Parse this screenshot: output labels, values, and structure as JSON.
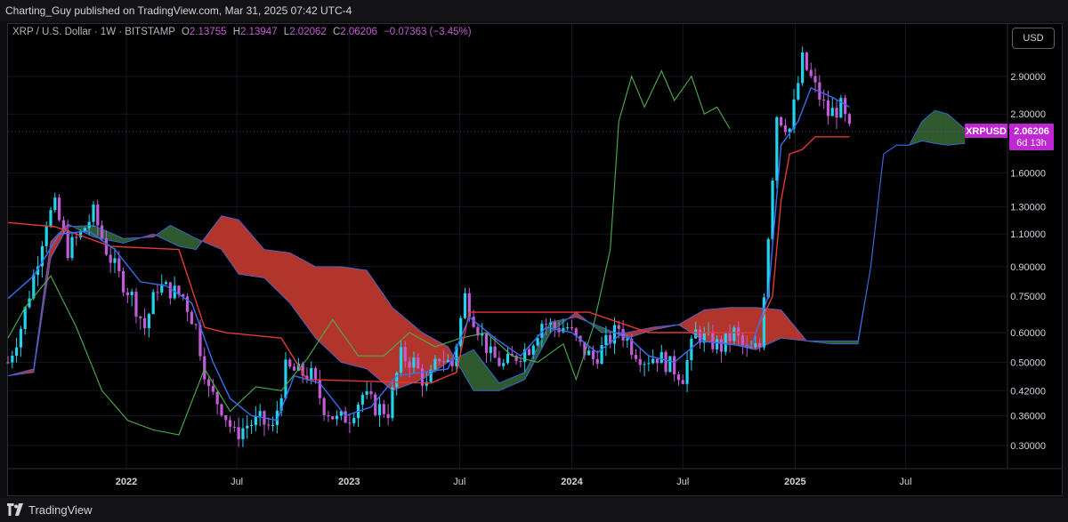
{
  "header": {
    "text": "Charting_Guy published on TradingView.com, Mar 31, 2025 07:42 UTC-4"
  },
  "legend": {
    "symbol": "XRP / U.S. Dollar · 1W · BITSTAMP",
    "o_label": "O",
    "o": "2.13755",
    "h_label": "H",
    "h": "2.13947",
    "l_label": "L",
    "l": "2.02062",
    "c_label": "C",
    "c": "2.06206",
    "change": "−0.07363 (−3.45%)"
  },
  "currency_button": "USD",
  "price_tag": {
    "symbol": "XRPUSD",
    "price": "2.06206",
    "countdown": "6d 13h"
  },
  "footer": {
    "brand": "TradingView"
  },
  "colors": {
    "background": "#000000",
    "bull": "#22d3ee",
    "bear": "#c45bd6",
    "tenkan": "#3b6df2",
    "kijun": "#e53935",
    "chikou": "#4caf50",
    "cloud_bull": "#2e5a2e",
    "cloud_bear": "#b2352b",
    "tag": "#c026d3"
  },
  "chart_data": {
    "type": "line",
    "title": "",
    "scale": "log",
    "ylim": [
      0.26,
      4.0
    ],
    "y_ticks": [
      "2.90000",
      "2.30000",
      "1.60000",
      "1.30000",
      "1.10000",
      "0.90000",
      "0.75000",
      "0.60000",
      "0.50000",
      "0.42000",
      "0.36000",
      "0.30000"
    ],
    "y_tick_values": [
      2.9,
      2.3,
      1.6,
      1.3,
      1.1,
      0.9,
      0.75,
      0.6,
      0.5,
      0.42,
      0.36,
      0.3
    ],
    "x_ticks": [
      {
        "label": "2022",
        "date": "2022-01-01"
      },
      {
        "label": "Jul",
        "date": "2022-07-01"
      },
      {
        "label": "2023",
        "date": "2023-01-01"
      },
      {
        "label": "Jul",
        "date": "2023-07-01"
      },
      {
        "label": "2024",
        "date": "2024-01-01"
      },
      {
        "label": "Jul",
        "date": "2024-07-01"
      },
      {
        "label": "2025",
        "date": "2025-01-01"
      },
      {
        "label": "Jul",
        "date": "2025-07-01"
      }
    ],
    "x_range": [
      "2021-06-21",
      "2025-12-15"
    ],
    "last_price": 2.06206,
    "price_path": [
      [
        "2021-06-21",
        0.5
      ],
      [
        "2021-07-12",
        0.62
      ],
      [
        "2021-08-02",
        0.85
      ],
      [
        "2021-08-23",
        1.2
      ],
      [
        "2021-09-06",
        1.3
      ],
      [
        "2021-09-27",
        1.0
      ],
      [
        "2021-10-18",
        1.1
      ],
      [
        "2021-11-08",
        1.25
      ],
      [
        "2021-11-29",
        1.0
      ],
      [
        "2021-12-20",
        0.85
      ],
      [
        "2022-01-10",
        0.75
      ],
      [
        "2022-01-31",
        0.62
      ],
      [
        "2022-02-21",
        0.8
      ],
      [
        "2022-03-14",
        0.78
      ],
      [
        "2022-04-04",
        0.75
      ],
      [
        "2022-04-25",
        0.62
      ],
      [
        "2022-05-16",
        0.42
      ],
      [
        "2022-06-06",
        0.38
      ],
      [
        "2022-06-27",
        0.32
      ],
      [
        "2022-07-18",
        0.34
      ],
      [
        "2022-08-08",
        0.35
      ],
      [
        "2022-08-29",
        0.33
      ],
      [
        "2022-09-19",
        0.48
      ],
      [
        "2022-10-10",
        0.47
      ],
      [
        "2022-10-31",
        0.46
      ],
      [
        "2022-11-21",
        0.38
      ],
      [
        "2022-12-12",
        0.35
      ],
      [
        "2023-01-02",
        0.36
      ],
      [
        "2023-01-23",
        0.41
      ],
      [
        "2023-02-13",
        0.38
      ],
      [
        "2023-03-06",
        0.37
      ],
      [
        "2023-03-27",
        0.52
      ],
      [
        "2023-04-17",
        0.5
      ],
      [
        "2023-05-08",
        0.43
      ],
      [
        "2023-05-29",
        0.52
      ],
      [
        "2023-06-19",
        0.49
      ],
      [
        "2023-07-10",
        0.75
      ],
      [
        "2023-07-31",
        0.62
      ],
      [
        "2023-08-21",
        0.52
      ],
      [
        "2023-09-11",
        0.49
      ],
      [
        "2023-10-02",
        0.52
      ],
      [
        "2023-10-23",
        0.55
      ],
      [
        "2023-11-13",
        0.64
      ],
      [
        "2023-12-04",
        0.62
      ],
      [
        "2023-12-25",
        0.62
      ],
      [
        "2024-01-15",
        0.55
      ],
      [
        "2024-02-05",
        0.51
      ],
      [
        "2024-02-26",
        0.56
      ],
      [
        "2024-03-18",
        0.62
      ],
      [
        "2024-04-08",
        0.55
      ],
      [
        "2024-04-29",
        0.51
      ],
      [
        "2024-05-20",
        0.52
      ],
      [
        "2024-06-10",
        0.49
      ],
      [
        "2024-07-01",
        0.46
      ],
      [
        "2024-07-22",
        0.6
      ],
      [
        "2024-08-12",
        0.57
      ],
      [
        "2024-09-02",
        0.55
      ],
      [
        "2024-09-23",
        0.6
      ],
      [
        "2024-10-14",
        0.53
      ],
      [
        "2024-11-04",
        0.55
      ],
      [
        "2024-11-18",
        1.1
      ],
      [
        "2024-12-02",
        2.3
      ],
      [
        "2024-12-23",
        2.1
      ],
      [
        "2025-01-13",
        3.2
      ],
      [
        "2025-02-03",
        2.7
      ],
      [
        "2025-02-24",
        2.3
      ],
      [
        "2025-03-17",
        2.4
      ],
      [
        "2025-03-31",
        2.06206
      ]
    ],
    "series": [
      {
        "key": "tenkan",
        "points": [
          [
            "2021-06-21",
            0.74
          ],
          [
            "2021-08-02",
            0.85
          ],
          [
            "2021-09-13",
            1.1
          ],
          [
            "2021-11-01",
            1.12
          ],
          [
            "2021-12-13",
            1.0
          ],
          [
            "2022-01-24",
            0.82
          ],
          [
            "2022-03-07",
            0.8
          ],
          [
            "2022-04-18",
            0.72
          ],
          [
            "2022-05-23",
            0.5
          ],
          [
            "2022-06-20",
            0.4
          ],
          [
            "2022-07-25",
            0.36
          ],
          [
            "2022-09-05",
            0.35
          ],
          [
            "2022-10-03",
            0.46
          ],
          [
            "2022-11-14",
            0.44
          ],
          [
            "2022-12-26",
            0.36
          ],
          [
            "2023-02-06",
            0.38
          ],
          [
            "2023-03-20",
            0.46
          ],
          [
            "2023-05-01",
            0.47
          ],
          [
            "2023-06-12",
            0.48
          ],
          [
            "2023-07-17",
            0.66
          ],
          [
            "2023-08-28",
            0.58
          ],
          [
            "2023-10-09",
            0.52
          ],
          [
            "2023-11-20",
            0.62
          ],
          [
            "2024-01-01",
            0.6
          ],
          [
            "2024-02-12",
            0.53
          ],
          [
            "2024-03-25",
            0.6
          ],
          [
            "2024-05-06",
            0.52
          ],
          [
            "2024-06-17",
            0.5
          ],
          [
            "2024-07-29",
            0.57
          ],
          [
            "2024-09-09",
            0.56
          ],
          [
            "2024-10-21",
            0.55
          ],
          [
            "2024-11-18",
            0.75
          ],
          [
            "2024-12-09",
            1.9
          ],
          [
            "2025-01-06",
            2.2
          ],
          [
            "2025-01-27",
            2.7
          ],
          [
            "2025-03-03",
            2.55
          ],
          [
            "2025-03-31",
            2.4
          ]
        ]
      },
      {
        "key": "kijun",
        "points": [
          [
            "2021-06-21",
            1.18
          ],
          [
            "2021-09-06",
            1.15
          ],
          [
            "2021-10-25",
            1.08
          ],
          [
            "2021-12-06",
            1.02
          ],
          [
            "2022-03-28",
            1.0
          ],
          [
            "2022-05-09",
            0.62
          ],
          [
            "2022-06-13",
            0.6
          ],
          [
            "2022-09-12",
            0.58
          ],
          [
            "2022-10-24",
            0.45
          ],
          [
            "2023-05-15",
            0.44
          ],
          [
            "2023-06-26",
            0.47
          ],
          [
            "2023-07-17",
            0.68
          ],
          [
            "2024-01-29",
            0.68
          ],
          [
            "2024-05-06",
            0.6
          ],
          [
            "2024-10-28",
            0.6
          ],
          [
            "2024-11-25",
            0.75
          ],
          [
            "2024-12-09",
            1.35
          ],
          [
            "2024-12-23",
            1.8
          ],
          [
            "2025-01-13",
            1.85
          ],
          [
            "2025-02-03",
            2.0
          ],
          [
            "2025-03-31",
            2.0
          ]
        ]
      },
      {
        "key": "chikou",
        "points": [
          [
            "2021-06-21",
            0.58
          ],
          [
            "2021-07-19",
            0.7
          ],
          [
            "2021-08-30",
            0.85
          ],
          [
            "2021-10-11",
            0.62
          ],
          [
            "2021-11-22",
            0.42
          ],
          [
            "2022-01-03",
            0.35
          ],
          [
            "2022-02-14",
            0.33
          ],
          [
            "2022-03-28",
            0.32
          ],
          [
            "2022-05-09",
            0.48
          ],
          [
            "2022-06-20",
            0.37
          ],
          [
            "2022-08-01",
            0.43
          ],
          [
            "2022-09-12",
            0.42
          ],
          [
            "2022-10-24",
            0.51
          ],
          [
            "2022-12-05",
            0.65
          ],
          [
            "2023-01-16",
            0.52
          ],
          [
            "2023-02-27",
            0.52
          ],
          [
            "2023-04-10",
            0.6
          ],
          [
            "2023-05-22",
            0.55
          ],
          [
            "2023-07-03",
            0.58
          ],
          [
            "2023-08-14",
            0.6
          ],
          [
            "2023-09-25",
            0.52
          ],
          [
            "2023-11-06",
            0.5
          ],
          [
            "2023-12-18",
            0.56
          ],
          [
            "2024-01-08",
            0.45
          ],
          [
            "2024-02-05",
            0.62
          ],
          [
            "2024-03-04",
            1.0
          ],
          [
            "2024-03-18",
            2.2
          ],
          [
            "2024-04-08",
            2.9
          ],
          [
            "2024-04-29",
            2.4
          ],
          [
            "2024-05-27",
            3.0
          ],
          [
            "2024-06-17",
            2.5
          ],
          [
            "2024-07-15",
            2.9
          ],
          [
            "2024-08-05",
            2.3
          ],
          [
            "2024-08-26",
            2.4
          ],
          [
            "2024-09-16",
            2.1
          ]
        ]
      },
      {
        "key": "span_a",
        "points": [
          [
            "2021-06-21",
            0.46
          ],
          [
            "2021-08-02",
            0.47
          ],
          [
            "2021-08-30",
            0.95
          ],
          [
            "2021-09-27",
            1.15
          ],
          [
            "2021-11-08",
            1.16
          ],
          [
            "2021-12-27",
            1.07
          ],
          [
            "2022-02-14",
            1.08
          ],
          [
            "2022-03-14",
            1.16
          ],
          [
            "2022-04-25",
            1.07
          ],
          [
            "2022-06-06",
            1.0
          ],
          [
            "2022-07-04",
            0.86
          ],
          [
            "2022-08-15",
            0.84
          ],
          [
            "2022-09-26",
            0.72
          ],
          [
            "2022-11-07",
            0.58
          ],
          [
            "2022-12-19",
            0.5
          ],
          [
            "2023-01-30",
            0.48
          ],
          [
            "2023-03-13",
            0.42
          ],
          [
            "2023-05-01",
            0.45
          ],
          [
            "2023-06-12",
            0.5
          ],
          [
            "2023-07-24",
            0.54
          ],
          [
            "2023-09-04",
            0.44
          ],
          [
            "2023-10-16",
            0.47
          ],
          [
            "2023-11-27",
            0.64
          ],
          [
            "2024-01-08",
            0.66
          ],
          [
            "2024-02-19",
            0.62
          ],
          [
            "2024-04-01",
            0.58
          ],
          [
            "2024-05-13",
            0.61
          ],
          [
            "2024-06-24",
            0.63
          ],
          [
            "2024-08-05",
            0.57
          ],
          [
            "2024-09-16",
            0.56
          ],
          [
            "2024-10-28",
            0.54
          ],
          [
            "2024-12-09",
            0.58
          ],
          [
            "2025-01-20",
            0.57
          ],
          [
            "2025-03-03",
            0.57
          ],
          [
            "2025-04-14",
            0.57
          ],
          [
            "2025-05-05",
            0.9
          ],
          [
            "2025-05-26",
            1.8
          ],
          [
            "2025-06-16",
            1.9
          ],
          [
            "2025-07-07",
            1.9
          ],
          [
            "2025-07-28",
            2.2
          ],
          [
            "2025-08-18",
            2.35
          ],
          [
            "2025-09-08",
            2.3
          ],
          [
            "2025-10-06",
            2.1
          ]
        ]
      },
      {
        "key": "span_b",
        "points": [
          [
            "2021-06-21",
            0.46
          ],
          [
            "2021-08-02",
            0.48
          ],
          [
            "2021-08-30",
            1.05
          ],
          [
            "2021-09-27",
            1.17
          ],
          [
            "2021-11-08",
            1.08
          ],
          [
            "2021-12-27",
            1.04
          ],
          [
            "2022-02-14",
            1.1
          ],
          [
            "2022-03-28",
            1.02
          ],
          [
            "2022-04-25",
            1.0
          ],
          [
            "2022-06-06",
            1.23
          ],
          [
            "2022-07-04",
            1.2
          ],
          [
            "2022-08-15",
            1.0
          ],
          [
            "2022-09-26",
            0.98
          ],
          [
            "2022-11-07",
            0.9
          ],
          [
            "2022-12-19",
            0.9
          ],
          [
            "2023-01-30",
            0.88
          ],
          [
            "2023-03-13",
            0.7
          ],
          [
            "2023-05-01",
            0.6
          ],
          [
            "2023-06-12",
            0.55
          ],
          [
            "2023-07-24",
            0.42
          ],
          [
            "2023-09-04",
            0.42
          ],
          [
            "2023-10-16",
            0.45
          ],
          [
            "2023-11-27",
            0.6
          ],
          [
            "2024-01-08",
            0.68
          ],
          [
            "2024-02-19",
            0.6
          ],
          [
            "2024-04-01",
            0.6
          ],
          [
            "2024-05-13",
            0.62
          ],
          [
            "2024-06-24",
            0.63
          ],
          [
            "2024-08-05",
            0.69
          ],
          [
            "2024-09-16",
            0.7
          ],
          [
            "2024-10-28",
            0.7
          ],
          [
            "2024-12-09",
            0.69
          ],
          [
            "2025-01-20",
            0.57
          ],
          [
            "2025-03-03",
            0.56
          ],
          [
            "2025-04-14",
            0.56
          ],
          [
            "2025-05-05",
            0.9
          ],
          [
            "2025-05-26",
            1.8
          ],
          [
            "2025-06-16",
            1.9
          ],
          [
            "2025-07-07",
            1.9
          ],
          [
            "2025-07-28",
            1.95
          ],
          [
            "2025-08-18",
            1.92
          ],
          [
            "2025-09-08",
            1.9
          ],
          [
            "2025-10-06",
            1.92
          ]
        ]
      }
    ]
  }
}
